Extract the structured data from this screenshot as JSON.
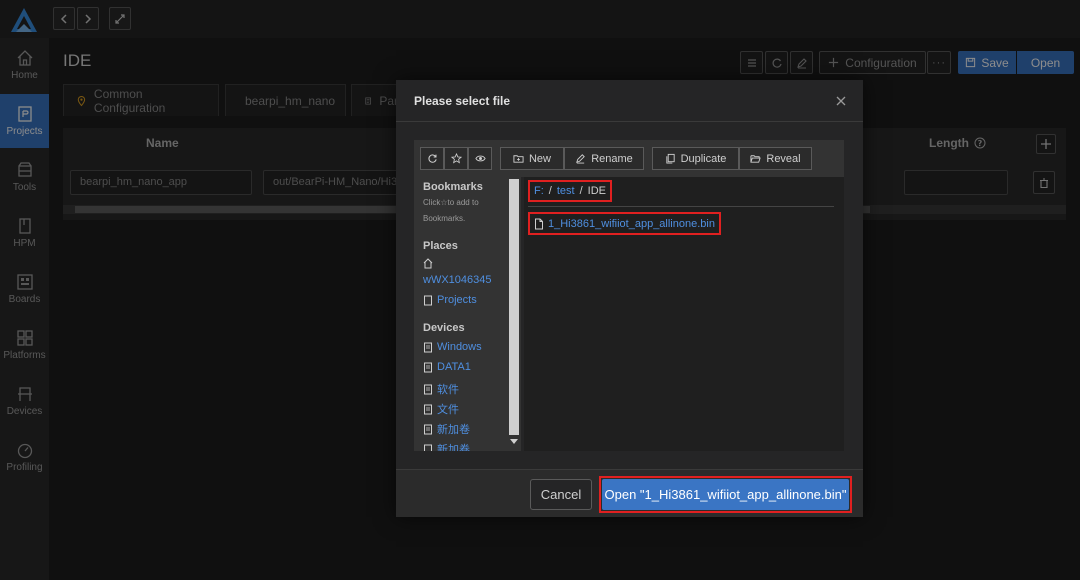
{
  "sidebar": {
    "items": [
      {
        "label": "Home",
        "icon": "home-icon"
      },
      {
        "label": "Projects",
        "icon": "projects-icon",
        "active": true
      },
      {
        "label": "Tools",
        "icon": "tools-icon"
      },
      {
        "label": "HPM",
        "icon": "hpm-icon"
      },
      {
        "label": "Boards",
        "icon": "boards-icon"
      },
      {
        "label": "Platforms",
        "icon": "platforms-icon"
      },
      {
        "label": "Devices",
        "icon": "devices-icon"
      },
      {
        "label": "Profiling",
        "icon": "profiling-icon"
      }
    ]
  },
  "header": {
    "title": "IDE",
    "configuration_label": "Configuration",
    "save_label": "Save",
    "open_label": "Open"
  },
  "tabs": [
    {
      "label": "Common Configuration",
      "icon": "location-pin-icon"
    },
    {
      "label": "bearpi_hm_nano",
      "icon": "location-pin-icon"
    },
    {
      "label": "Par",
      "icon": "document-icon"
    }
  ],
  "table": {
    "columns": {
      "name": "Name",
      "length": "Length"
    },
    "row": {
      "name": "bearpi_hm_nano_app",
      "path": "out/BearPi-HM_Nano/Hi3"
    }
  },
  "dialog": {
    "title": "Please select file",
    "toolbar": {
      "new_label": "New",
      "rename_label": "Rename",
      "duplicate_label": "Duplicate",
      "reveal_label": "Reveal"
    },
    "bookmarks": {
      "title": "Bookmarks",
      "hint_part1": "Click",
      "hint_part2": "to add to Bookmarks."
    },
    "places": {
      "title": "Places",
      "items": [
        "wWX1046345",
        "Projects"
      ]
    },
    "devices": {
      "title": "Devices",
      "items": [
        "Windows",
        "DATA1",
        "软件",
        "文件",
        "新加卷",
        "新加卷"
      ]
    },
    "breadcrumb": {
      "drive": "F:",
      "folder": "test",
      "current": "IDE",
      "separator": "/"
    },
    "file": "1_Hi3861_wifiiot_app_allinone.bin",
    "cancel_label": "Cancel",
    "confirm_label": "Open \"1_Hi3861_wifiiot_app_allinone.bin\""
  },
  "colors": {
    "accent": "#3a75c4",
    "link": "#4f8fe0",
    "highlight": "#e02020",
    "background": "#1e1e1e"
  }
}
